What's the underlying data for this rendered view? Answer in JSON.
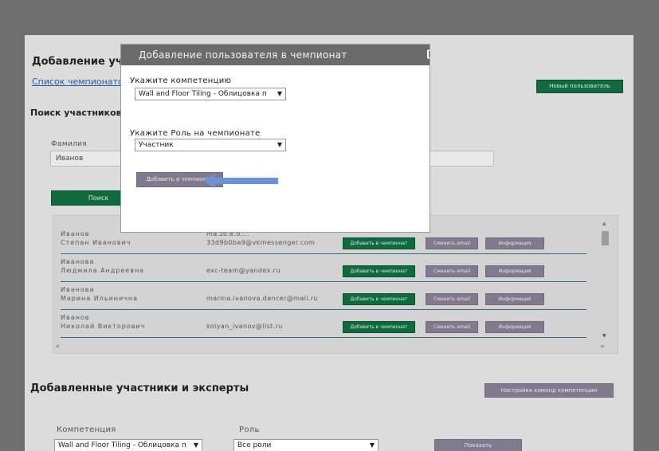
{
  "page": {
    "heading": "Добавление участ",
    "championships_link": "Список чемпионато",
    "new_user_button": "Новый пользователь",
    "search_heading": "Поиск участников в",
    "surname_label": "Фамилия",
    "surname_value": "Иванов",
    "search_button": "Поиск",
    "rows": [
      {
        "surname": "Иванов",
        "name": "Степан Иванович",
        "email": "33d9b0ba9@vkmessenger.com",
        "email_top": "ma.zo.e.o....",
        "add": "Добавить в чемпионат",
        "change_email": "Сменить email",
        "info": "Информация"
      },
      {
        "surname": "Иванова",
        "name": "Людмила Андреевна",
        "email": "exc-team@yandex.ru",
        "add": "Добавить в чемпионат",
        "change_email": "Сменить email",
        "info": "Информация"
      },
      {
        "surname": "Иванова",
        "name": "Марина Ильинична",
        "email": "marina.ivanova.dancer@mail.ru",
        "add": "Добавить в чемпионат",
        "change_email": "Сменить email",
        "info": "Информация"
      },
      {
        "surname": "Иванов",
        "name": "Николай Викторович",
        "email": "kolyan_ivanov@list.ru",
        "add": "Добавить в чемпионат",
        "change_email": "Сменить email",
        "info": "Информация"
      }
    ],
    "added_heading": "Добавленные участники и эксперты",
    "team_settings_button": "Настройка команд компетенции",
    "competence_label": "Компетенция",
    "competence_value": "Wall and Floor Tiling - Облицовка п",
    "role_label": "Роль",
    "role_value": "Все роли",
    "show_button": "Показать"
  },
  "modal": {
    "title": "Добавление пользователя в чемпионат",
    "close": "[",
    "competence_label": "Укажите компетенцию",
    "competence_value": "Wall and Floor Tiling - Облицовка п",
    "role_label": "Укажите Роль на чемпионате",
    "role_value": "Участник",
    "add_button": "Добавить в чемпионат"
  },
  "colors": {
    "green_button": "#0f6b3f",
    "gray_button": "#7f7a8c",
    "overlay": "#6f6f6f",
    "arrow": "#6b93d6"
  }
}
